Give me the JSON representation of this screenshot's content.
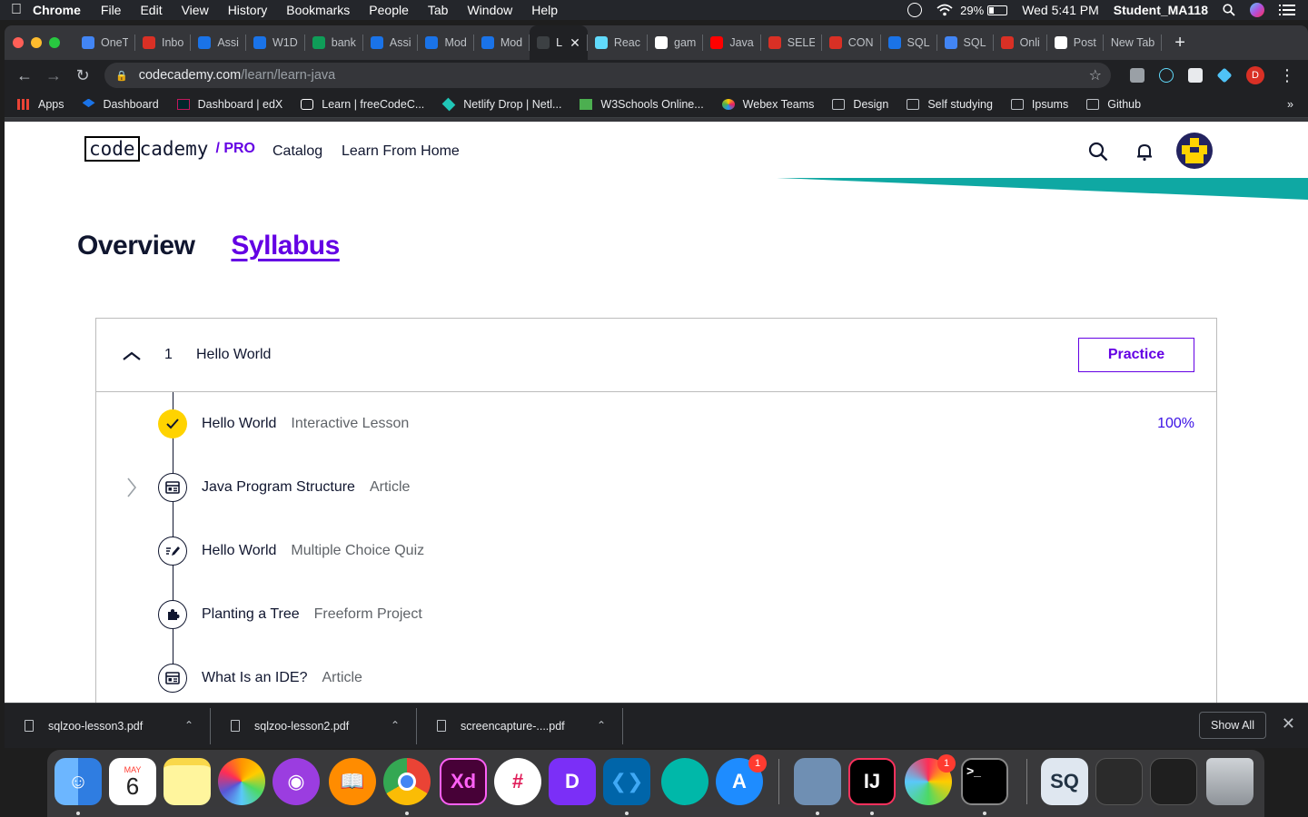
{
  "menubar": {
    "app": "Chrome",
    "items": [
      "File",
      "Edit",
      "View",
      "History",
      "Bookmarks",
      "People",
      "Tab",
      "Window",
      "Help"
    ],
    "battery": "29%",
    "clock": "Wed 5:41 PM",
    "user": "Student_MA118"
  },
  "browser": {
    "tabs": [
      {
        "label": "OneT",
        "color": "#4285f4"
      },
      {
        "label": "Inbo",
        "color": "#d93025"
      },
      {
        "label": "Assi",
        "color": "#1a73e8"
      },
      {
        "label": "W1D",
        "color": "#1a73e8"
      },
      {
        "label": "bank",
        "color": "#0f9d58"
      },
      {
        "label": "Assi",
        "color": "#1a73e8"
      },
      {
        "label": "Mod",
        "color": "#1a73e8"
      },
      {
        "label": "Mod",
        "color": "#1a73e8"
      },
      {
        "label": "L",
        "color": "#3c4043",
        "active": true
      },
      {
        "label": "Reac",
        "color": "#61dafb"
      },
      {
        "label": "gam",
        "color": "#ffffff"
      },
      {
        "label": "Java",
        "color": "#ff0000"
      },
      {
        "label": "SELE",
        "color": "#d93025"
      },
      {
        "label": "CON",
        "color": "#d93025"
      },
      {
        "label": "SQL",
        "color": "#1a73e8"
      },
      {
        "label": "SQL",
        "color": "#4285f4"
      },
      {
        "label": "Onli",
        "color": "#d93025"
      },
      {
        "label": "Post",
        "color": "#ffffff"
      },
      {
        "label": "New Tab",
        "color": ""
      }
    ],
    "url_host": "codecademy.com",
    "url_path": "/learn/learn-java",
    "profile_initial": "D",
    "bookmarks": [
      {
        "label": "Apps",
        "icon": "apps-icon"
      },
      {
        "label": "Dashboard",
        "icon": "dashboard-icon"
      },
      {
        "label": "Dashboard | edX",
        "icon": "edx-icon"
      },
      {
        "label": "Learn | freeCodeC...",
        "icon": "freecodecamp-icon"
      },
      {
        "label": "Netlify Drop | Netl...",
        "icon": "netlify-icon"
      },
      {
        "label": "W3Schools Online...",
        "icon": "w3schools-icon"
      },
      {
        "label": "Webex Teams",
        "icon": "webex-icon"
      },
      {
        "label": "Design",
        "icon": "folder-icon"
      },
      {
        "label": "Self studying",
        "icon": "folder-icon"
      },
      {
        "label": "Ipsums",
        "icon": "folder-icon"
      },
      {
        "label": "Github",
        "icon": "folder-icon"
      }
    ],
    "bookmarks_overflow": "»"
  },
  "site": {
    "logo_code": "code",
    "logo_cademy": "cademy",
    "logo_pro": "/ PRO",
    "nav": [
      "Catalog",
      "Learn From Home"
    ],
    "accent": "#6400e4",
    "teal": "#0fa8a3"
  },
  "course": {
    "tabs": [
      "Overview",
      "Syllabus"
    ],
    "active_tab": "Syllabus",
    "module": {
      "number": "1",
      "title": "Hello World",
      "action": "Practice",
      "lessons": [
        {
          "title": "Hello World",
          "type": "Interactive Lesson",
          "status": "complete",
          "progress": "100%"
        },
        {
          "title": "Java Program Structure",
          "type": "Article",
          "status": "article"
        },
        {
          "title": "Hello World",
          "type": "Multiple Choice Quiz",
          "status": "quiz"
        },
        {
          "title": "Planting a Tree",
          "type": "Freeform Project",
          "status": "project"
        },
        {
          "title": "What Is an IDE?",
          "type": "Article",
          "status": "article"
        }
      ]
    }
  },
  "downloads": {
    "files": [
      "sqlzoo-lesson3.pdf",
      "sqlzoo-lesson2.pdf",
      "screencapture-....pdf"
    ],
    "show_all": "Show All"
  },
  "dock": {
    "calendar_month": "MAY",
    "calendar_day": "6",
    "badges": {
      "app_store": "1",
      "screen_recorder": "1"
    }
  }
}
